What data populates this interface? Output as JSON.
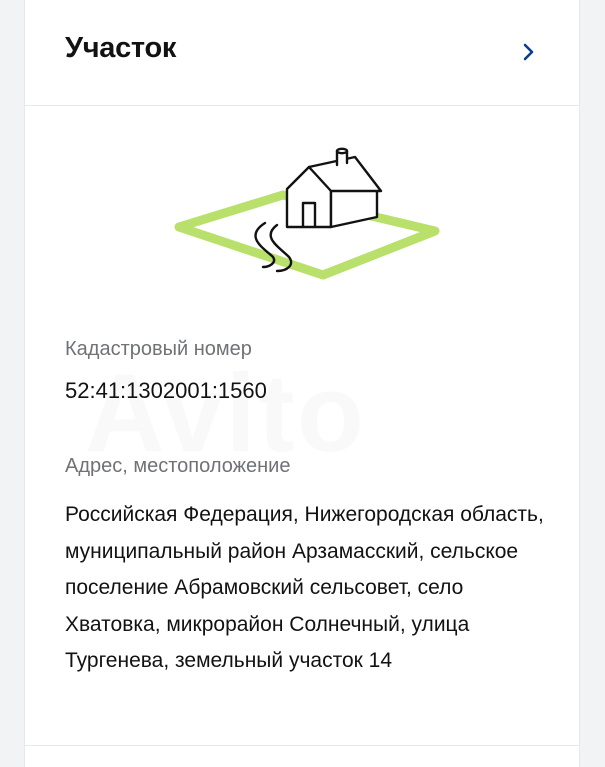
{
  "header": {
    "title": "Участок",
    "chevron_icon": "chevron-right-icon"
  },
  "cadastral": {
    "label": "Кадастровый номер",
    "value": "52:41:1302001:1560"
  },
  "address": {
    "label": "Адрес, местоположение",
    "value": "Российская Федерация, Нижегородская область, муниципальный район Арзамасский, сельское поселение Абрамовский сельсовет, село Хватовка, микрорайон Солнечный, улица Тургенева, земельный участок 14"
  },
  "colors": {
    "accent": "#0a3d8f",
    "plot_green": "#b8e06a",
    "text_primary": "#121212",
    "text_secondary": "#6f7276"
  }
}
